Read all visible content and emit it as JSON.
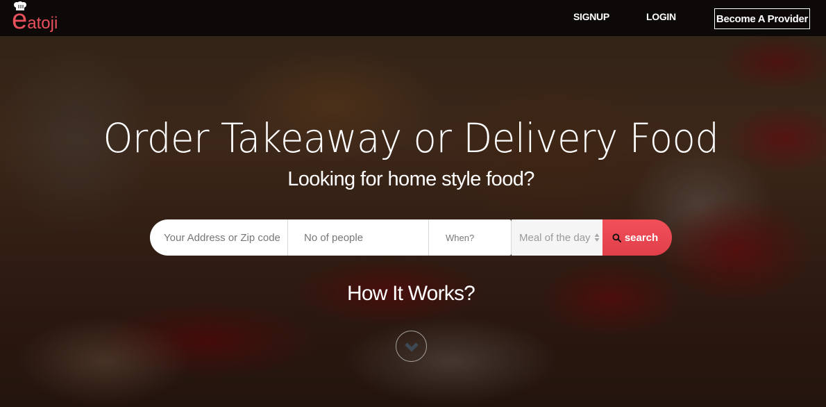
{
  "brand": {
    "logo_e": "e",
    "logo_rest": "atoji",
    "accent_color": "#e8505b"
  },
  "nav": {
    "signup_label": "SIGNUP",
    "login_label": "LOGIN",
    "provider_label": "Become A Provider"
  },
  "hero": {
    "headline": "Order Takeaway or Delivery Food",
    "subheadline": "Looking for home style food?"
  },
  "search": {
    "address_placeholder": "Your Address or Zip code",
    "people_placeholder": "No of people",
    "when_placeholder": "When?",
    "meal_selected": "Meal of the day",
    "button_label": "search",
    "button_icon": "search-icon",
    "button_color": "#ee4a54"
  },
  "how_it_works": {
    "label": "How It Works?",
    "scroll_icon": "chevron-down-icon"
  }
}
